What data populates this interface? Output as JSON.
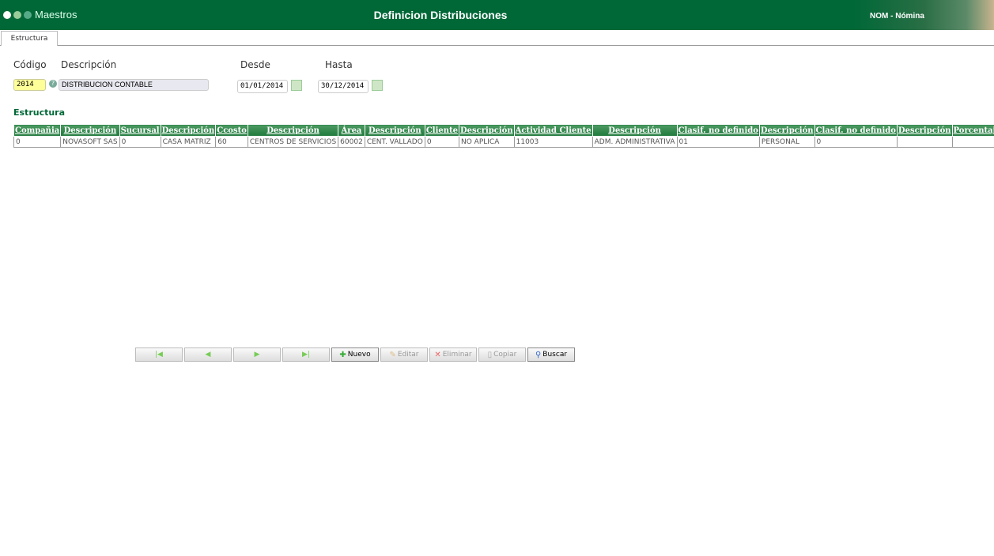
{
  "header": {
    "module": "Maestros",
    "title": "Definicion Distribuciones",
    "app": "NOM - Nómina"
  },
  "tabs": [
    {
      "label": "Estructura"
    }
  ],
  "form": {
    "codigo_label": "Código",
    "descripcion_label": "Descripción",
    "desde_label": "Desde",
    "hasta_label": "Hasta",
    "codigo": "2014",
    "descripcion": "DISTRIBUCION CONTABLE",
    "desde": "01/01/2014",
    "hasta": "30/12/2014"
  },
  "section_title": "Estructura",
  "table": {
    "headers": [
      "Compañia",
      "Descripción",
      "Sucursal",
      "Descripción",
      "Ccosto",
      "Descripción",
      "Área",
      "Descripción",
      "Cliente",
      "Descripción",
      "Actividad Cliente",
      "Descripción",
      "Clasif. no definido",
      "Descripción",
      "Clasif. no definido",
      "Descripción",
      "Porcentaje"
    ],
    "rows": [
      [
        "0",
        "NOVASOFT SAS",
        "0",
        "CASA MATRIZ",
        "60",
        "CENTROS DE SERVICIOS",
        "60002",
        "CENT. VALLADO",
        "0",
        "NO APLICA",
        "11003",
        "ADM. ADMINISTRATIVA",
        "01",
        "PERSONAL",
        "0",
        "",
        ""
      ]
    ]
  },
  "toolbar": {
    "first": "",
    "prev": "",
    "next": "",
    "last": "",
    "nuevo": "Nuevo",
    "editar": "Editar",
    "eliminar": "Eliminar",
    "copiar": "Copiar",
    "buscar": "Buscar"
  }
}
